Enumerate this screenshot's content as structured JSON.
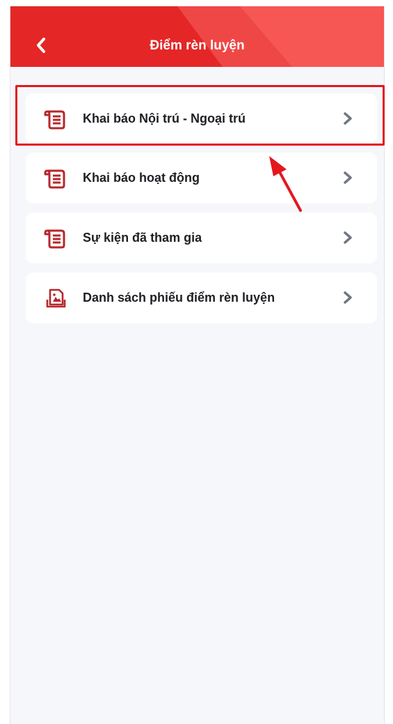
{
  "header": {
    "title": "Điểm rèn luyện",
    "background_color": "#e42726",
    "back_icon": "chevron-left-icon"
  },
  "menu": {
    "items": [
      {
        "label": "Khai báo Nội trú - Ngoại trú",
        "icon": "document-list-icon"
      },
      {
        "label": "Khai báo hoạt động",
        "icon": "document-list-icon"
      },
      {
        "label": "Sự kiện đã tham gia",
        "icon": "document-list-icon"
      },
      {
        "label": "Danh sách phiếu điểm rèn luyện",
        "icon": "image-document-icon"
      }
    ],
    "icon_color": "#b6272b",
    "chevron_color": "#707784"
  },
  "annotation": {
    "highlight_color": "#e4171f",
    "highlighted_item": "Khai báo Nội trú - Ngoại trú"
  }
}
